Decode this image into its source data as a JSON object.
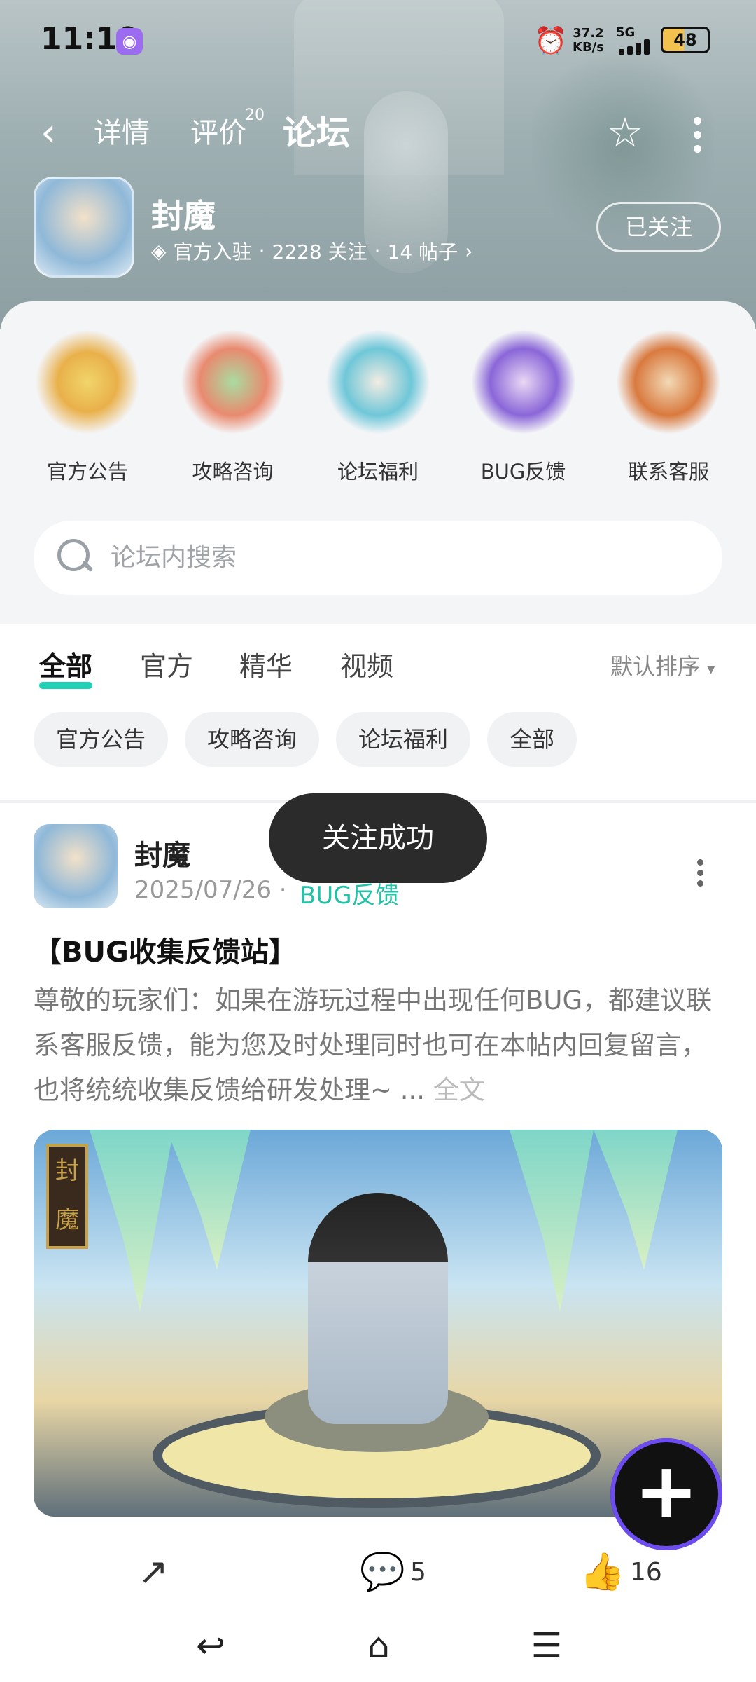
{
  "status_bar": {
    "time": "11:10",
    "net_speed_value": "37.2",
    "net_speed_unit": "KB/s",
    "network": "5G",
    "battery": "48"
  },
  "nav": {
    "tabs": [
      "详情",
      "评价",
      "论坛"
    ],
    "review_badge": "20",
    "active_tab": "论坛"
  },
  "app": {
    "name": "封魔",
    "official": "官方入驻",
    "followers": "2228 关注",
    "posts": "14 帖子",
    "follow_button": "已关注"
  },
  "categories": [
    "官方公告",
    "攻略咨询",
    "论坛福利",
    "BUG反馈",
    "联系客服"
  ],
  "search": {
    "placeholder": "论坛内搜索"
  },
  "filters": {
    "tabs": [
      "全部",
      "官方",
      "精华",
      "视频"
    ],
    "sort": "默认排序"
  },
  "chips": [
    "官方公告",
    "攻略咨询",
    "论坛福利",
    "全部"
  ],
  "post": {
    "author": "封魔",
    "date": "2025/07/26",
    "category": "BUG反馈",
    "title": "【BUG收集反馈站】",
    "body": "尊敬的玩家们：如果在游玩过程中出现任何BUG，都建议联系客服反馈，能为您及时处理同时也可在本帖内回复留言，也将统统收集反馈给研发处理~ ...",
    "full_text": "全文",
    "image_sign": "封魔",
    "comments": "5",
    "likes": "16"
  },
  "toast": "关注成功",
  "colors": {
    "accent": "#22d0b5",
    "fab_ring": "#6d4cf0"
  }
}
